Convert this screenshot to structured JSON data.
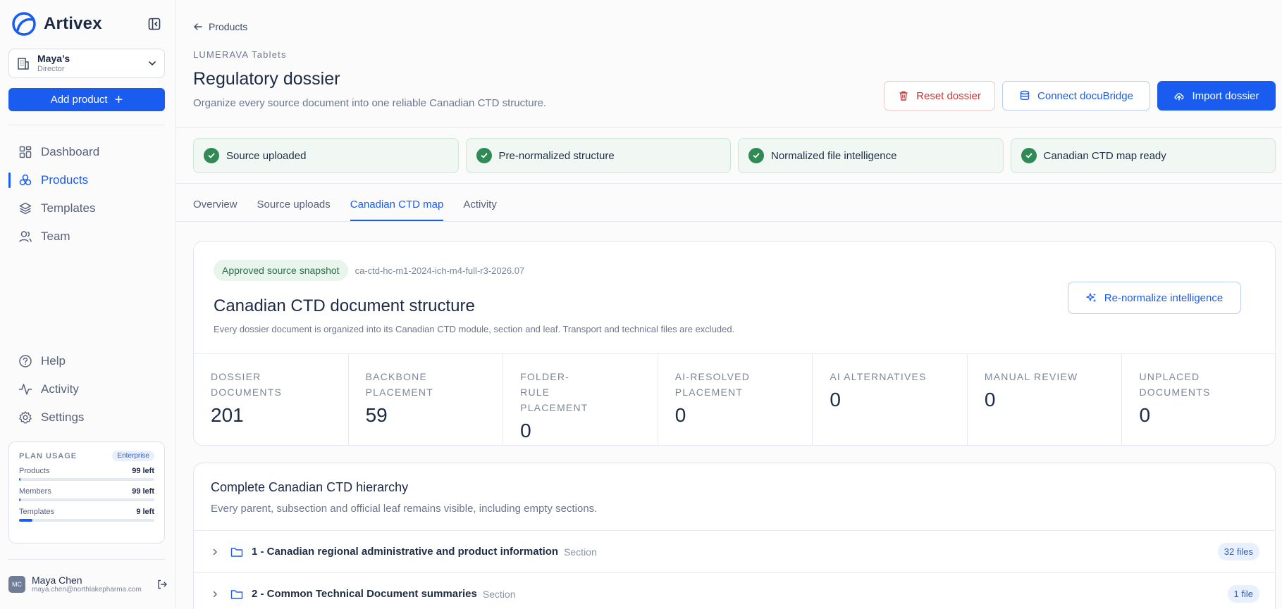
{
  "brand": {
    "name": "Artivex",
    "accent": "#1a5cf0"
  },
  "org": {
    "name": "Maya’s",
    "role": "Director"
  },
  "sidebar": {
    "add_product": "Add product",
    "nav": [
      {
        "label": "Dashboard",
        "icon": "grid-icon",
        "active": false
      },
      {
        "label": "Products",
        "icon": "products-icon",
        "active": true
      },
      {
        "label": "Templates",
        "icon": "layers-icon",
        "active": false
      },
      {
        "label": "Team",
        "icon": "users-icon",
        "active": false
      }
    ],
    "bottom_nav": [
      {
        "label": "Help",
        "icon": "help-icon"
      },
      {
        "label": "Activity",
        "icon": "activity-icon"
      },
      {
        "label": "Settings",
        "icon": "gear-icon"
      }
    ]
  },
  "plan": {
    "title": "PLAN USAGE",
    "badge": "Enterprise",
    "rows": [
      {
        "label": "Products",
        "value": "99 left",
        "used_fraction": 0.01
      },
      {
        "label": "Members",
        "value": "99 left",
        "used_fraction": 0.01
      },
      {
        "label": "Templates",
        "value": "9 left",
        "used_fraction": 0.1
      }
    ]
  },
  "user": {
    "initials": "MC",
    "name": "Maya Chen",
    "email": "maya.chen@northlakepharma.com"
  },
  "header": {
    "back": "Products",
    "eyebrow": "LUMERAVA Tablets",
    "title": "Regulatory dossier",
    "subtitle": "Organize every source document into one reliable Canadian CTD structure.",
    "reset": "Reset dossier",
    "connect": "Connect docuBridge",
    "import": "Import dossier"
  },
  "steps": [
    {
      "label": "Source uploaded",
      "status": "done"
    },
    {
      "label": "Pre-normalized structure",
      "status": "done"
    },
    {
      "label": "Normalized file intelligence",
      "status": "done"
    },
    {
      "label": "Canadian CTD map ready",
      "status": "done"
    }
  ],
  "tabs": [
    {
      "label": "Overview",
      "active": false
    },
    {
      "label": "Source uploads",
      "active": false
    },
    {
      "label": "Canadian CTD map",
      "active": true
    },
    {
      "label": "Activity",
      "active": false
    }
  ],
  "structure": {
    "snapshot_label": "Approved source snapshot",
    "snapshot_id": "ca-ctd-hc-m1-2024-ich-m4-full-r3-2026.07",
    "title": "Canadian CTD document structure",
    "subtitle": "Every dossier document is organized into its Canadian CTD module, section and leaf. Transport and technical files are excluded.",
    "renormalize": "Re-normalize intelligence",
    "stats": [
      {
        "label": "Dossier documents",
        "value": "201"
      },
      {
        "label": "Backbone placement",
        "value": "59"
      },
      {
        "label": "Folder-rule placement",
        "value": "0"
      },
      {
        "label": "AI-resolved placement",
        "value": "0"
      },
      {
        "label": "AI alternatives",
        "value": "0"
      },
      {
        "label": "Manual review",
        "value": "0"
      },
      {
        "label": "Unplaced documents",
        "value": "0"
      }
    ]
  },
  "hierarchy": {
    "title": "Complete Canadian CTD hierarchy",
    "subtitle": "Every parent, subsection and official leaf remains visible, including empty sections.",
    "rows": [
      {
        "name": "1 - Canadian regional administrative and product information",
        "type": "Section",
        "count": "32 files"
      },
      {
        "name": "2 - Common Technical Document summaries",
        "type": "Section",
        "count": "1 file"
      }
    ]
  }
}
